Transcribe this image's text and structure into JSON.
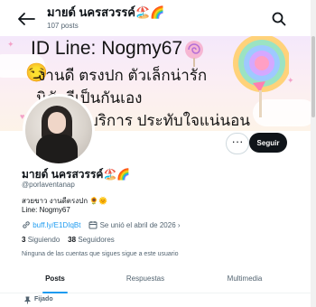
{
  "header": {
    "name": "มายด์ นครสวรรค์🏖️🌈",
    "posts_count": "107 posts"
  },
  "banner": {
    "line1": "ID Line: Nogmy67",
    "line2": "งานดี ตรงปก ตัวเล็กน่ารัก",
    "line3": "นิสัยดีเป็นกันเอง",
    "line4": "บริการ ประทับใจแน่นอน"
  },
  "actions": {
    "more": "···",
    "follow": "Seguir"
  },
  "profile": {
    "name": "มายด์ นครสวรรค์🏖️🌈",
    "handle": "@porlaventanap",
    "bio_line1": "สวยขาว งานดีตรงปก 🌻🌞",
    "bio_line2": "Line: Nogmy67",
    "link": "buff.ly/E1DIqBt",
    "joined": "Se unió el abril de 2026",
    "following_count": "3",
    "following_label": "Siguiendo",
    "followers_count": "38",
    "followers_label": "Seguidores",
    "no_mutuals": "Ninguna de las cuentas que sigues sigue a este usuario"
  },
  "tabs": [
    {
      "label": "Posts"
    },
    {
      "label": "Respuestas"
    },
    {
      "label": "Multimedia"
    }
  ],
  "pinned_label": "Fijado",
  "icons": {
    "back": "arrow-left-icon",
    "search": "search-icon",
    "link": "link-icon",
    "calendar": "calendar-icon",
    "pin": "pin-icon"
  },
  "colors": {
    "accent": "#1d9bf0",
    "button_dark": "#0f1419",
    "muted": "#536471"
  }
}
